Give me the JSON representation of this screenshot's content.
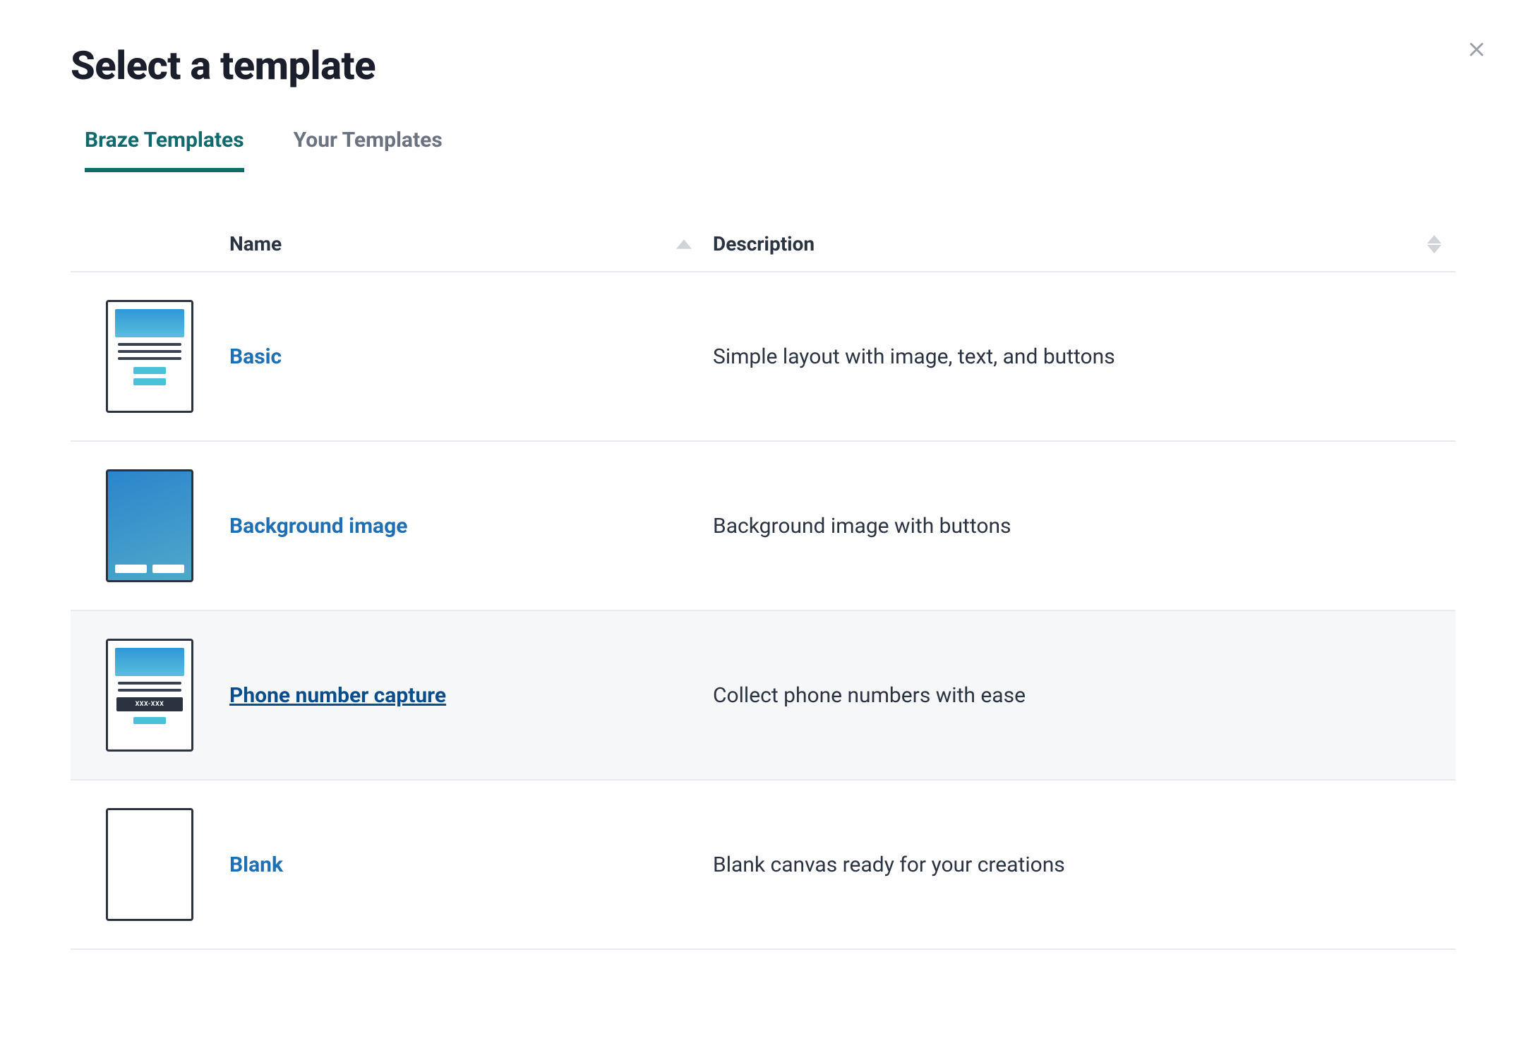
{
  "title": "Select a template",
  "tabs": [
    {
      "label": "Braze Templates",
      "active": true
    },
    {
      "label": "Your Templates",
      "active": false
    }
  ],
  "columns": {
    "name": "Name",
    "description": "Description"
  },
  "templates": [
    {
      "name": "Basic",
      "description": "Simple layout with image, text, and buttons",
      "thumb": "basic",
      "hovered": false
    },
    {
      "name": "Background image",
      "description": "Background image with buttons",
      "thumb": "bg",
      "hovered": false
    },
    {
      "name": "Phone number capture",
      "description": "Collect phone numbers with ease",
      "thumb": "phone",
      "thumb_input_label": "XXX-XXX",
      "hovered": true
    },
    {
      "name": "Blank",
      "description": "Blank canvas ready for your creations",
      "thumb": "blank",
      "hovered": false
    }
  ]
}
